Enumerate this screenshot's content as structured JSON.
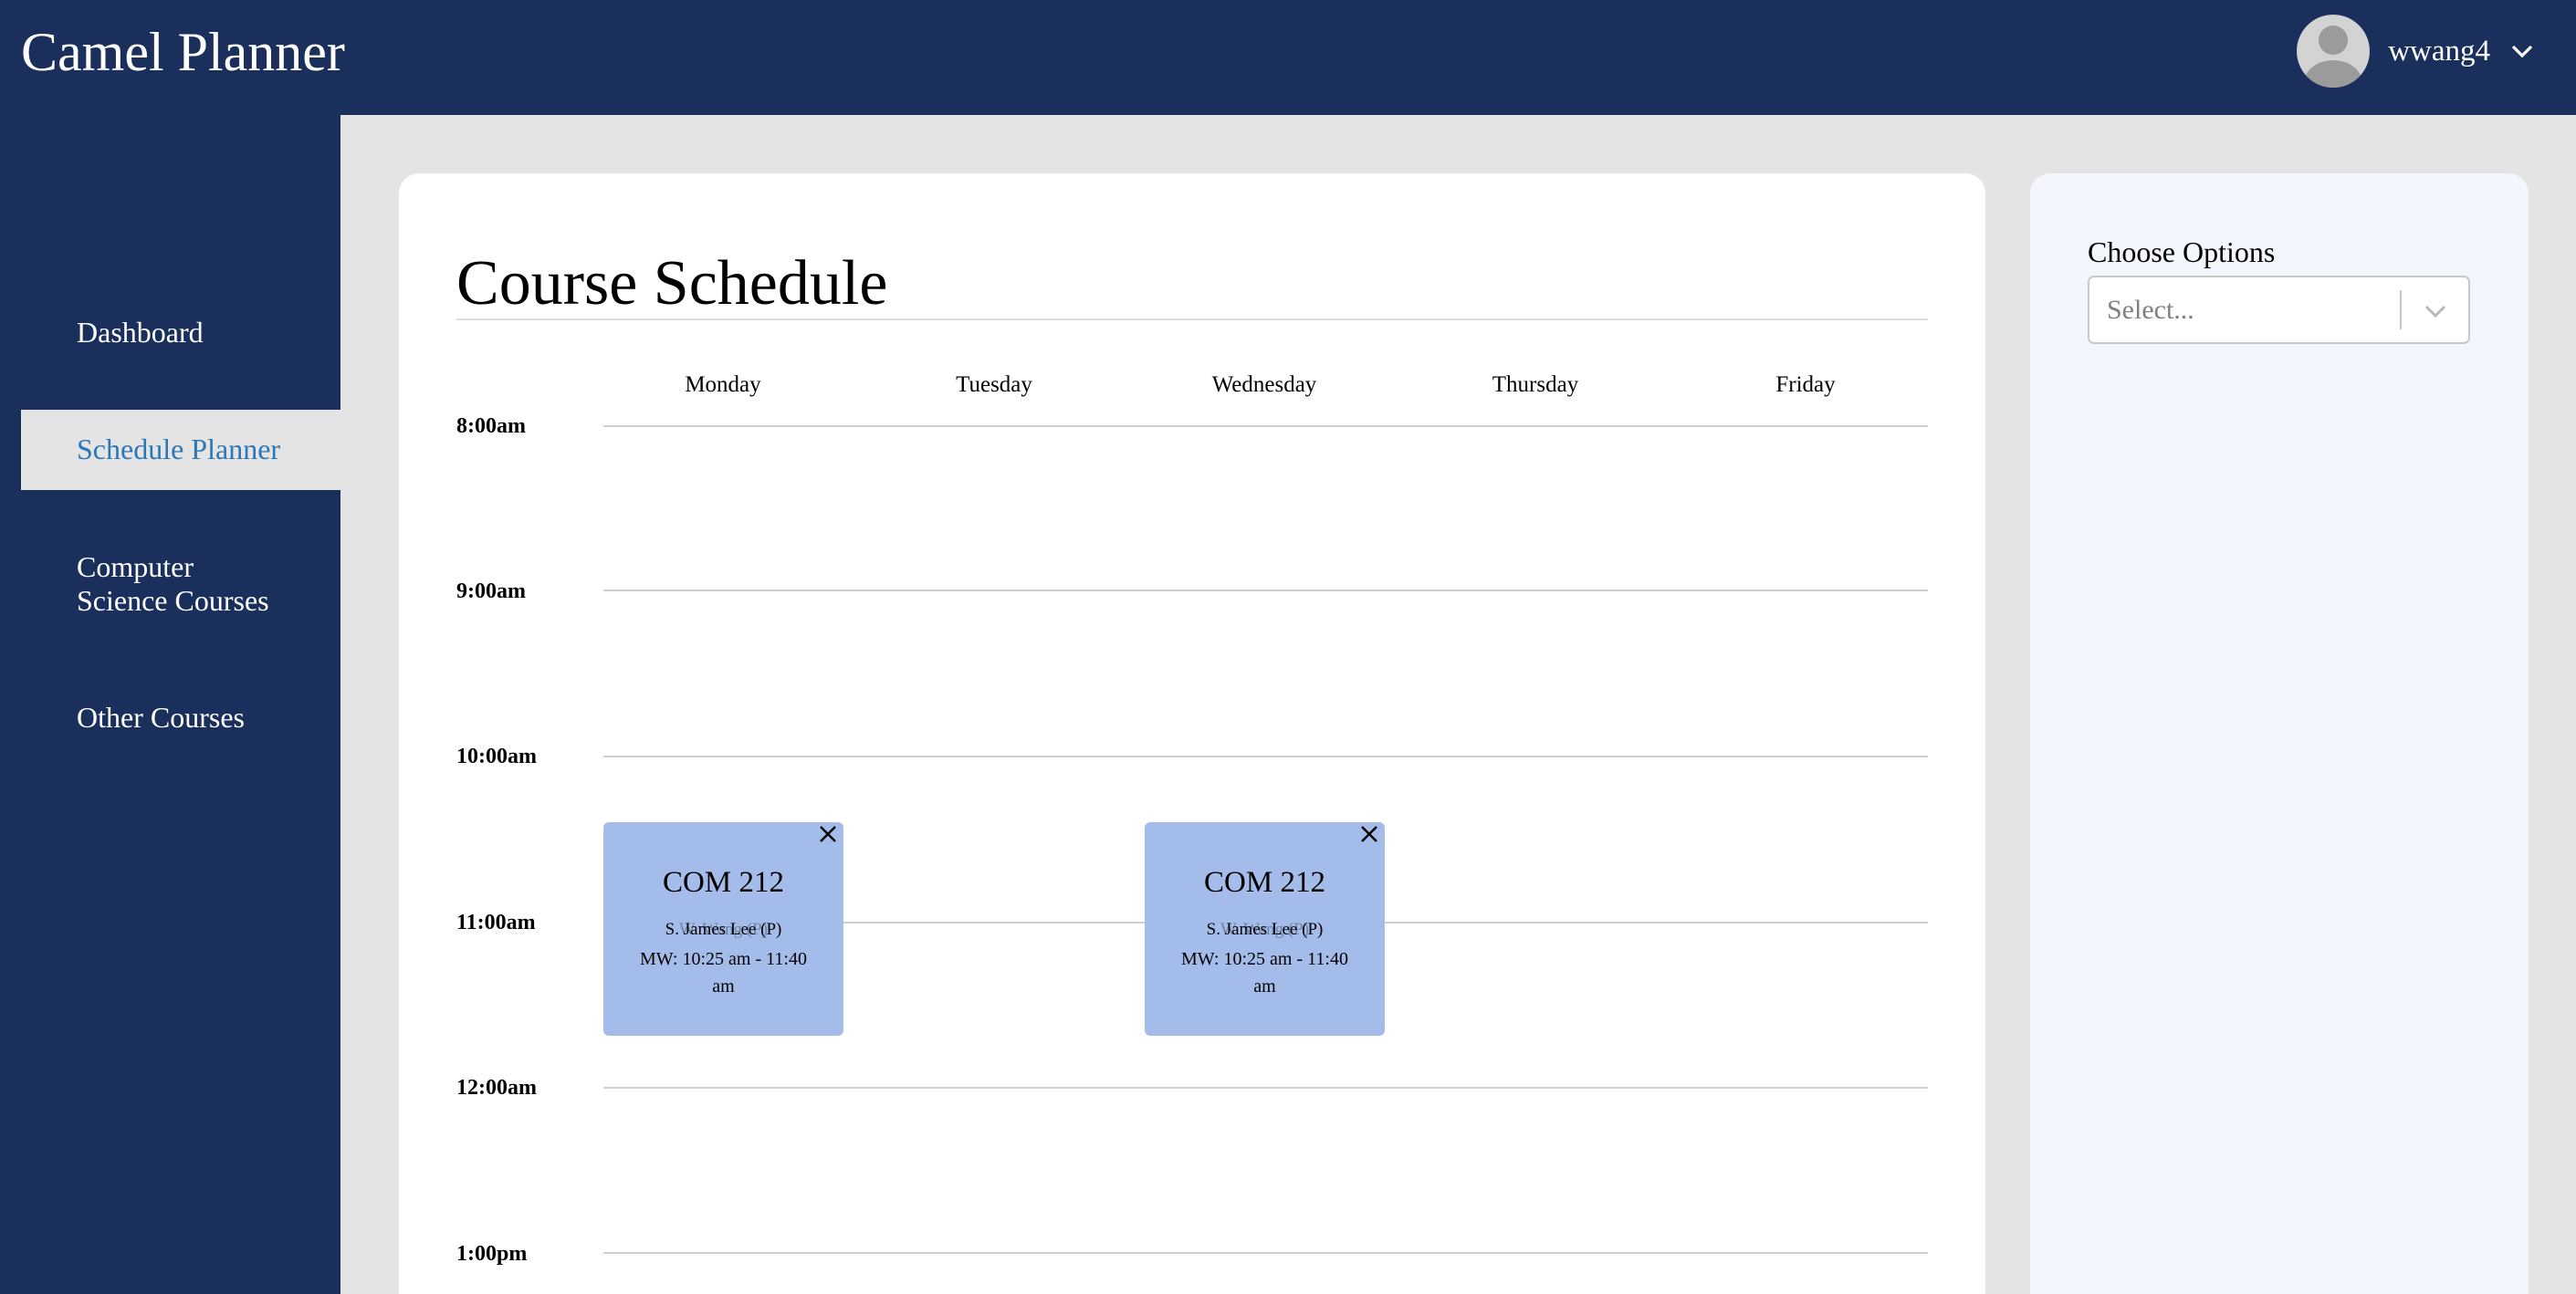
{
  "app": {
    "title": "Camel Planner"
  },
  "user": {
    "name": "wwang4"
  },
  "sidebar": {
    "items": [
      {
        "label": "Dashboard",
        "active": false
      },
      {
        "label": "Schedule Planner",
        "active": true
      },
      {
        "label": "Computer Science Courses",
        "active": false
      },
      {
        "label": "Other Courses",
        "active": false
      }
    ]
  },
  "schedule": {
    "title": "Course Schedule",
    "days": [
      "Monday",
      "Tuesday",
      "Wednesday",
      "Thursday",
      "Friday"
    ],
    "times": [
      "8:00am",
      "9:00am",
      "10:00am",
      "11:00am",
      "12:00am",
      "1:00pm"
    ],
    "events": [
      {
        "day": "Monday",
        "code": "COM 212",
        "ghost_text": "W. Wang (P)",
        "instructor": "S. James Lee (P)",
        "schedule": "MW: 10:25 am - 11:40 am"
      },
      {
        "day": "Wednesday",
        "code": "COM 212",
        "ghost_text": "W. Wang (P)",
        "instructor": "S. James Lee (P)",
        "schedule": "MW: 10:25 am - 11:40 am"
      }
    ]
  },
  "options": {
    "label": "Choose Options",
    "select_placeholder": "Select..."
  },
  "icons": {
    "user_menu": "chevron-down-icon",
    "event_remove": "close-icon",
    "select_dropdown": "chevron-down-icon",
    "avatar": "user-avatar-icon"
  },
  "colors": {
    "navy": "#1a2f5c",
    "active_nav_text": "#2b77b7",
    "event_block": "#a4bce9",
    "panel_bg": "#f3f7fd"
  }
}
